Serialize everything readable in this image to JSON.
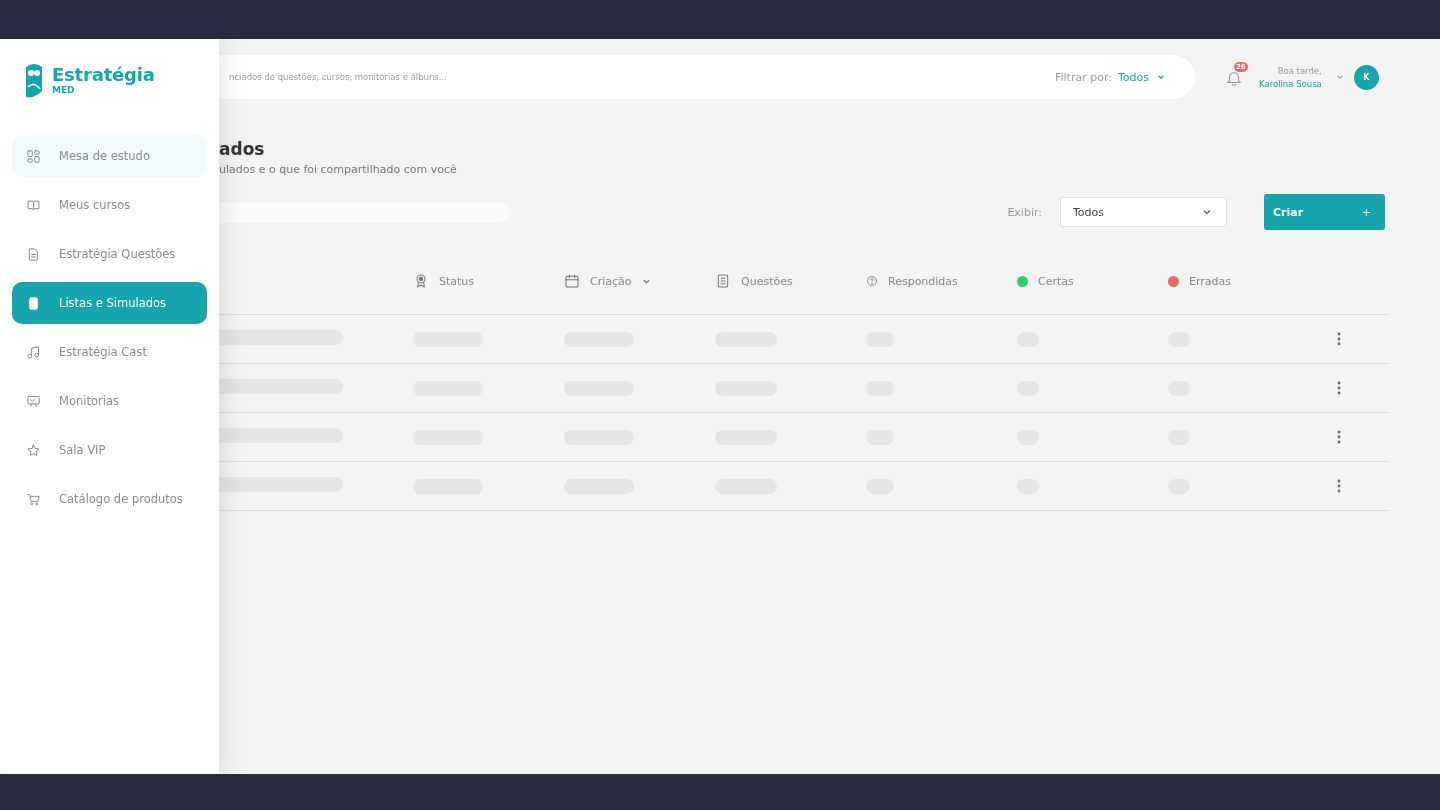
{
  "sidebar": {
    "logo": {
      "name": "Estratégia",
      "tag": "MED"
    },
    "items": [
      {
        "label": "Mesa de estudo",
        "kind": "grid",
        "selected": false,
        "hovered": true
      },
      {
        "label": "Meus cursos",
        "kind": "book",
        "selected": false,
        "hovered": false
      },
      {
        "label": "Estratégia Questões",
        "kind": "doc",
        "selected": false,
        "hovered": false
      },
      {
        "label": "Listas e Simulados",
        "kind": "notebook",
        "selected": true,
        "hovered": false
      },
      {
        "label": "Estratégia Cast",
        "kind": "music",
        "selected": false,
        "hovered": false
      },
      {
        "label": "Monitorias",
        "kind": "board",
        "selected": false,
        "hovered": false
      },
      {
        "label": "Sala VIP",
        "kind": "star",
        "selected": false,
        "hovered": false
      },
      {
        "label": "Catálogo de produtos",
        "kind": "cart",
        "selected": false,
        "hovered": false
      }
    ]
  },
  "topbar": {
    "search": {
      "placeholder": "nciados de questões, cursos, monitorias e álbuns..."
    },
    "filter": {
      "label": "Filtrar por:",
      "value": "Todos"
    },
    "notifications": {
      "count": "26"
    },
    "greeting": "Boa tarde,",
    "user_name": "Karolina Sousa",
    "avatar_letter": "K"
  },
  "page": {
    "title": "ados",
    "subtitle": "ulados e o que foi compartilhado com você",
    "show": {
      "label": "Exibir:",
      "value": "Todos"
    },
    "create_button": {
      "label": "Criar",
      "icon": "+"
    }
  },
  "table": {
    "columns": [
      {
        "label": "Status",
        "kind": "award",
        "sortable": false
      },
      {
        "label": "Criação",
        "kind": "calendar",
        "sortable": true
      },
      {
        "label": "Questões",
        "kind": "document",
        "sortable": false
      },
      {
        "label": "Respondidas",
        "kind": "question",
        "sortable": false
      },
      {
        "label": "Certas",
        "kind": "dot",
        "color": "#2ecc71",
        "sortable": false
      },
      {
        "label": "Erradas",
        "kind": "dot",
        "color": "#e86a6a",
        "sortable": false
      }
    ],
    "rows": [
      {
        "loading": true
      },
      {
        "loading": true
      },
      {
        "loading": true
      },
      {
        "loading": true
      }
    ]
  }
}
